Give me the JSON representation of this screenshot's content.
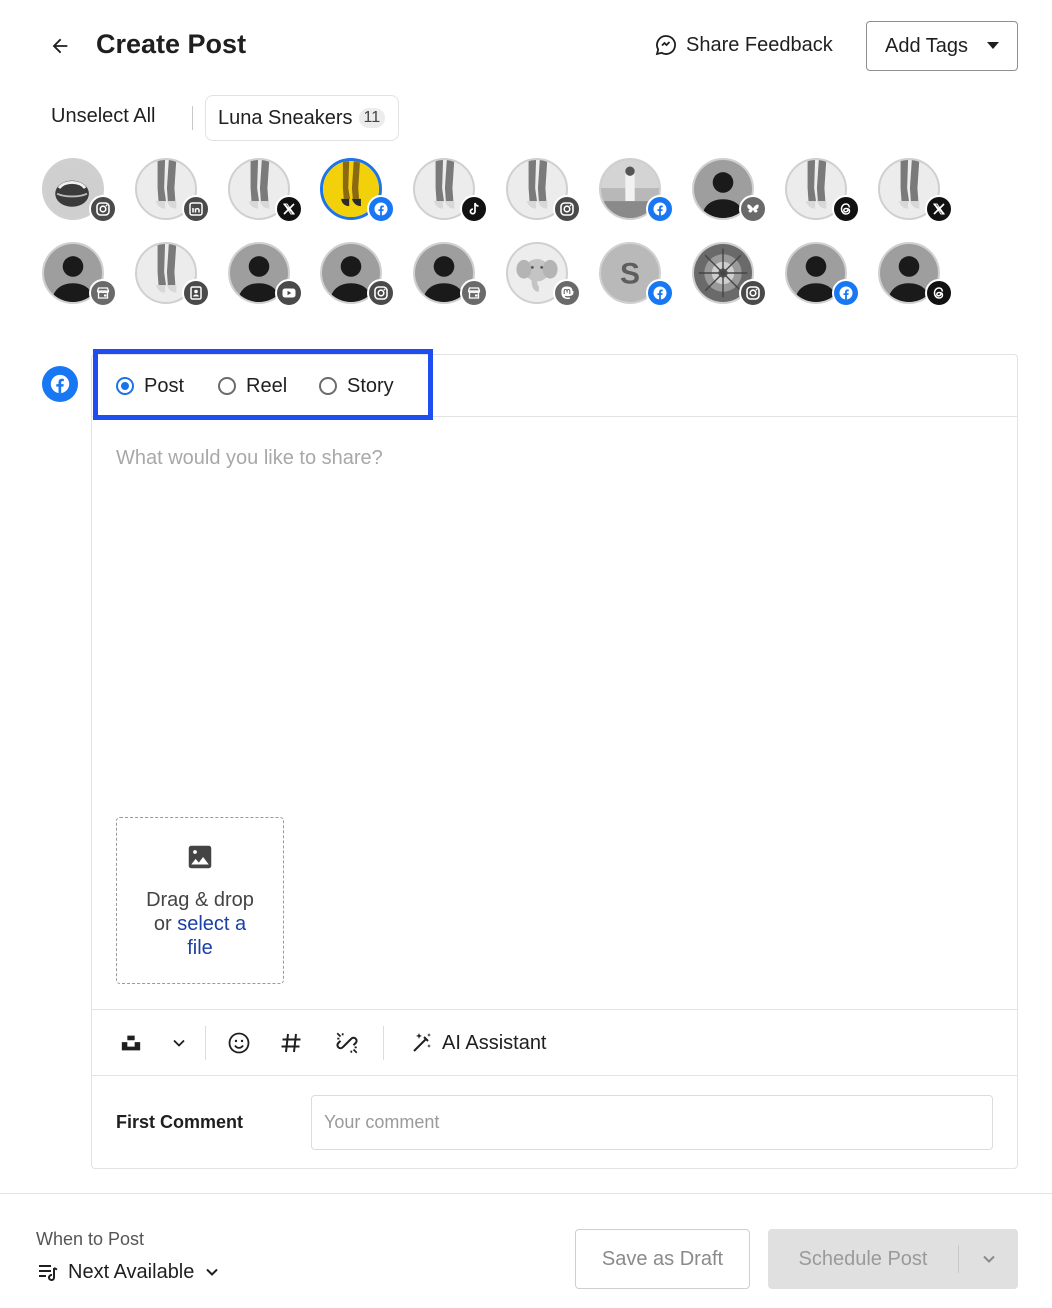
{
  "header": {
    "title": "Create Post",
    "share_feedback": "Share Feedback",
    "add_tags": "Add Tags"
  },
  "selection": {
    "unselect_all": "Unselect All",
    "group_name": "Luna Sneakers",
    "group_count": "11"
  },
  "accounts": [
    {
      "row": 1,
      "avatar": "photo-dark",
      "network": "instagram",
      "selected": false
    },
    {
      "row": 1,
      "avatar": "photo-legs",
      "network": "linkedin",
      "selected": false
    },
    {
      "row": 1,
      "avatar": "photo-legs",
      "network": "x",
      "selected": false
    },
    {
      "row": 1,
      "avatar": "photo-yellow",
      "network": "facebook",
      "selected": true
    },
    {
      "row": 1,
      "avatar": "photo-legs",
      "network": "tiktok",
      "selected": false
    },
    {
      "row": 1,
      "avatar": "photo-legs",
      "network": "instagram",
      "selected": false
    },
    {
      "row": 1,
      "avatar": "photo-street",
      "network": "facebook",
      "selected": false
    },
    {
      "row": 1,
      "avatar": "default-user",
      "network": "bluesky",
      "selected": false
    },
    {
      "row": 1,
      "avatar": "photo-legs",
      "network": "threads",
      "selected": false
    },
    {
      "row": 1,
      "avatar": "photo-legs",
      "network": "x",
      "selected": false
    },
    {
      "row": 2,
      "avatar": "default-user",
      "network": "google-business",
      "selected": false
    },
    {
      "row": 2,
      "avatar": "photo-legs",
      "network": "contact-card",
      "selected": false
    },
    {
      "row": 2,
      "avatar": "default-user",
      "network": "youtube",
      "selected": false
    },
    {
      "row": 2,
      "avatar": "default-user",
      "network": "instagram",
      "selected": false
    },
    {
      "row": 2,
      "avatar": "default-user",
      "network": "google-business",
      "selected": false
    },
    {
      "row": 2,
      "avatar": "elephant",
      "network": "mastodon",
      "selected": false
    },
    {
      "row": 2,
      "avatar": "letter-s",
      "network": "facebook",
      "selected": false
    },
    {
      "row": 2,
      "avatar": "photo-ornament",
      "network": "instagram",
      "selected": false
    },
    {
      "row": 2,
      "avatar": "default-user",
      "network": "facebook",
      "selected": false
    },
    {
      "row": 2,
      "avatar": "default-user",
      "network": "threads",
      "selected": false
    }
  ],
  "letter_avatar": "S",
  "editor": {
    "network": "facebook",
    "post_types": [
      {
        "label": "Post",
        "checked": true
      },
      {
        "label": "Reel",
        "checked": false
      },
      {
        "label": "Story",
        "checked": false
      }
    ],
    "placeholder": "What would you like to share?",
    "dropzone": {
      "line1": "Drag & drop",
      "line2_prefix": "or ",
      "link1": "select a",
      "link2": "file"
    },
    "toolbar": {
      "ai_assistant": "AI Assistant",
      "icons": [
        "unsplash-icon",
        "chevron-down-icon",
        "emoji-icon",
        "hashtag-icon",
        "link-shortener-icon",
        "magic-wand-icon"
      ]
    },
    "first_comment": {
      "label": "First Comment",
      "placeholder": "Your comment"
    }
  },
  "footer": {
    "when_label": "When to Post",
    "when_value": "Next Available",
    "save_draft": "Save as Draft",
    "schedule": "Schedule Post"
  },
  "colors": {
    "facebook": "#1877f2",
    "highlight": "#1e4df0",
    "radio_checked": "#1a73e8",
    "link": "#1a3fa8",
    "disabled_bg": "#e0e0e0"
  }
}
